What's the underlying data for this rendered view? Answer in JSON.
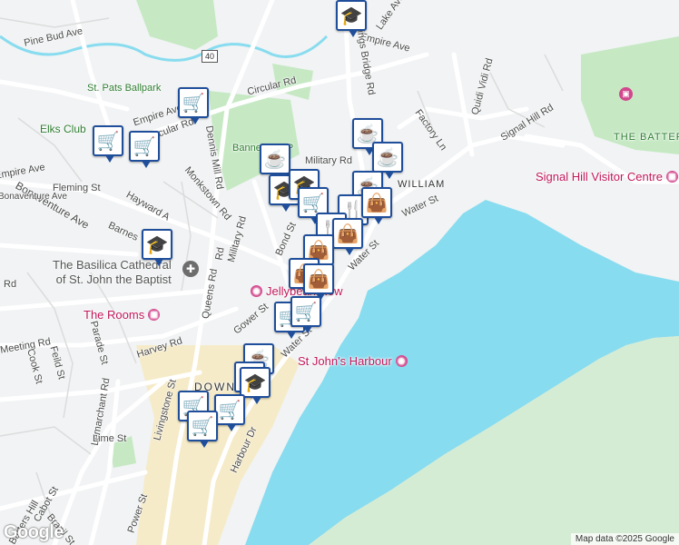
{
  "map": {
    "attribution": "Map data ©2025 Google",
    "logo": "Google",
    "route_shield": "40",
    "colors": {
      "water": "#88dcef",
      "land": "#f1f3f4",
      "park": "#c6e9c4",
      "road": "#ffffff",
      "downtown": "#f6ebc8",
      "marker_border": "#1f4e9a",
      "poi_pink": "#d2478d",
      "poi_grey": "#6d6d6d"
    },
    "street_labels": [
      "Pine Bud Ave",
      "Empire Ave",
      "Lake Ave",
      "Kings Bridge Rd",
      "Quidi Vidi Rd",
      "St. Pats Ballpark",
      "Circular Rd",
      "Signal Hill Rd",
      "Factory Ln",
      "Empire Ave",
      "Circular Rd",
      "Elks Club",
      "Military Rd",
      "Empire Ave",
      "Fleming St",
      "Monkstown Rd",
      "Hayward A",
      "Bonaventure Ave",
      "Barnes",
      "Military Rd",
      "Bond St",
      "Queens Rd",
      "Gower St",
      "Water St",
      "Water St",
      "Water St",
      "Harvey Rd",
      "Parade St",
      "Cook St",
      "Feild St",
      "Meeting Rd",
      "Lemarchant Rd",
      "Livingstone St",
      "Lime St",
      "Harbour Dr",
      "Cabot St",
      "Barters Hill",
      "Power St",
      "Brazil St",
      "Bannerman P",
      "DOWN",
      "WILLIAM",
      "Rd",
      "Rd",
      "Dennis Mill Rd",
      "Bonaventure Ave"
    ],
    "poi_labels": {
      "battery": "THE BATTERY",
      "visitor_centre": "Signal Hill Visitor Centre",
      "basilica_line1": "The Basilica Cathedral",
      "basilica_line2": "of St. John the Baptist",
      "rooms": "The Rooms",
      "jellybean": "Jellybean Row",
      "harbour": "St John's Harbour"
    },
    "markers": [
      {
        "icon": "school-icon",
        "glyph": "🎓"
      },
      {
        "icon": "shopping-cart-icon",
        "glyph": "🛒"
      },
      {
        "icon": "shopping-cart-icon",
        "glyph": "🛒"
      },
      {
        "icon": "shopping-cart-icon",
        "glyph": "🛒"
      },
      {
        "icon": "coffee-icon",
        "glyph": "☕"
      },
      {
        "icon": "coffee-icon",
        "glyph": "☕"
      },
      {
        "icon": "coffee-icon",
        "glyph": "☕"
      },
      {
        "icon": "school-icon",
        "glyph": "🎓"
      },
      {
        "icon": "school-icon",
        "glyph": "🎓"
      },
      {
        "icon": "shopping-cart-icon",
        "glyph": "🛒"
      },
      {
        "icon": "coffee-icon",
        "glyph": "☕"
      },
      {
        "icon": "restaurant-icon",
        "glyph": "🍴"
      },
      {
        "icon": "shopping-bag-icon",
        "glyph": "👜"
      },
      {
        "icon": "restaurant-icon",
        "glyph": "🍴"
      },
      {
        "icon": "shopping-bag-icon",
        "glyph": "👜"
      },
      {
        "icon": "shopping-bag-icon",
        "glyph": "👜"
      },
      {
        "icon": "shopping-bag-icon",
        "glyph": "👜"
      },
      {
        "icon": "shopping-bag-icon",
        "glyph": "👜"
      },
      {
        "icon": "shopping-cart-icon",
        "glyph": "🛒"
      },
      {
        "icon": "school-icon",
        "glyph": "🎓"
      },
      {
        "icon": "coffee-icon",
        "glyph": "☕"
      },
      {
        "icon": "school-icon",
        "glyph": "🎓"
      },
      {
        "icon": "school-icon",
        "glyph": "🎓"
      },
      {
        "icon": "shopping-cart-icon",
        "glyph": "🛒"
      },
      {
        "icon": "shopping-cart-icon",
        "glyph": "🛒"
      },
      {
        "icon": "shopping-cart-icon",
        "glyph": "🛒"
      },
      {
        "icon": "shopping-cart-icon",
        "glyph": "🛒"
      }
    ]
  }
}
